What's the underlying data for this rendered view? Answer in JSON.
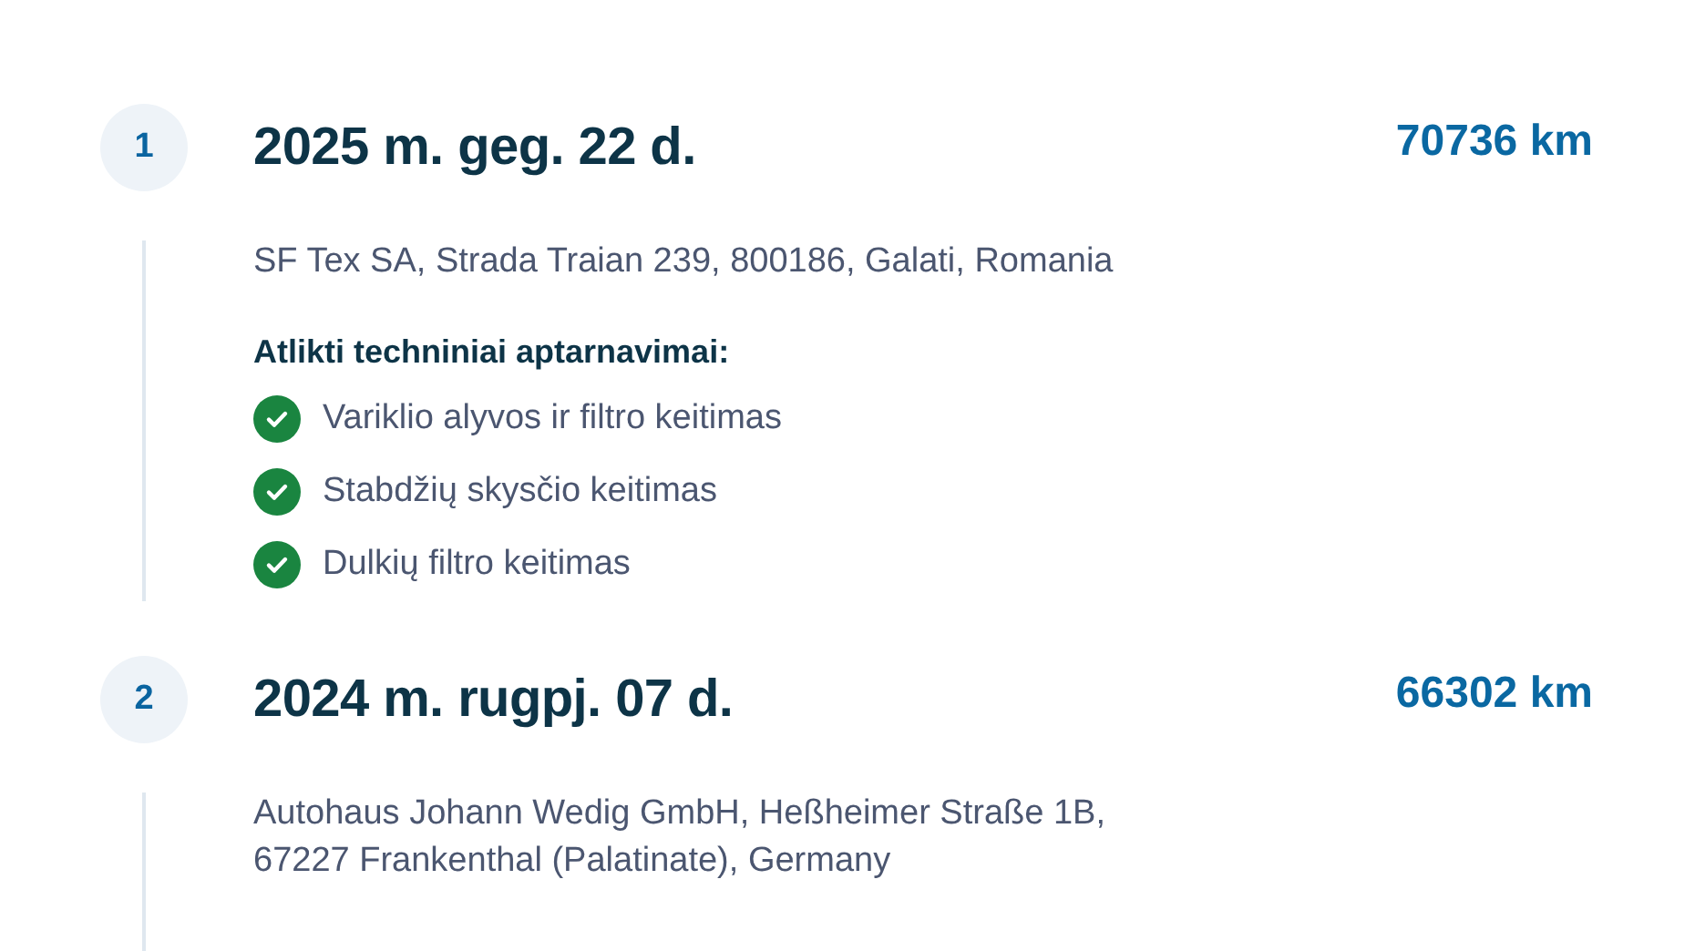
{
  "entries": [
    {
      "number": "1",
      "date": "2025 m. geg. 22 d.",
      "mileage": "70736 km",
      "address_lines": [
        "SF Tex SA, Strada Traian 239, 800186, Galati, Romania"
      ],
      "services_heading": "Atlikti techniniai aptarnavimai:",
      "services": [
        "Variklio alyvos ir filtro keitimas",
        "Stabdžių skysčio keitimas",
        "Dulkių filtro keitimas"
      ]
    },
    {
      "number": "2",
      "date": "2024 m. rugpj. 07 d.",
      "mileage": "66302 km",
      "address_lines": [
        "Autohaus Johann Wedig GmbH, Heßheimer Straße 1B,",
        "67227 Frankenthal (Palatinate), Germany"
      ]
    }
  ]
}
